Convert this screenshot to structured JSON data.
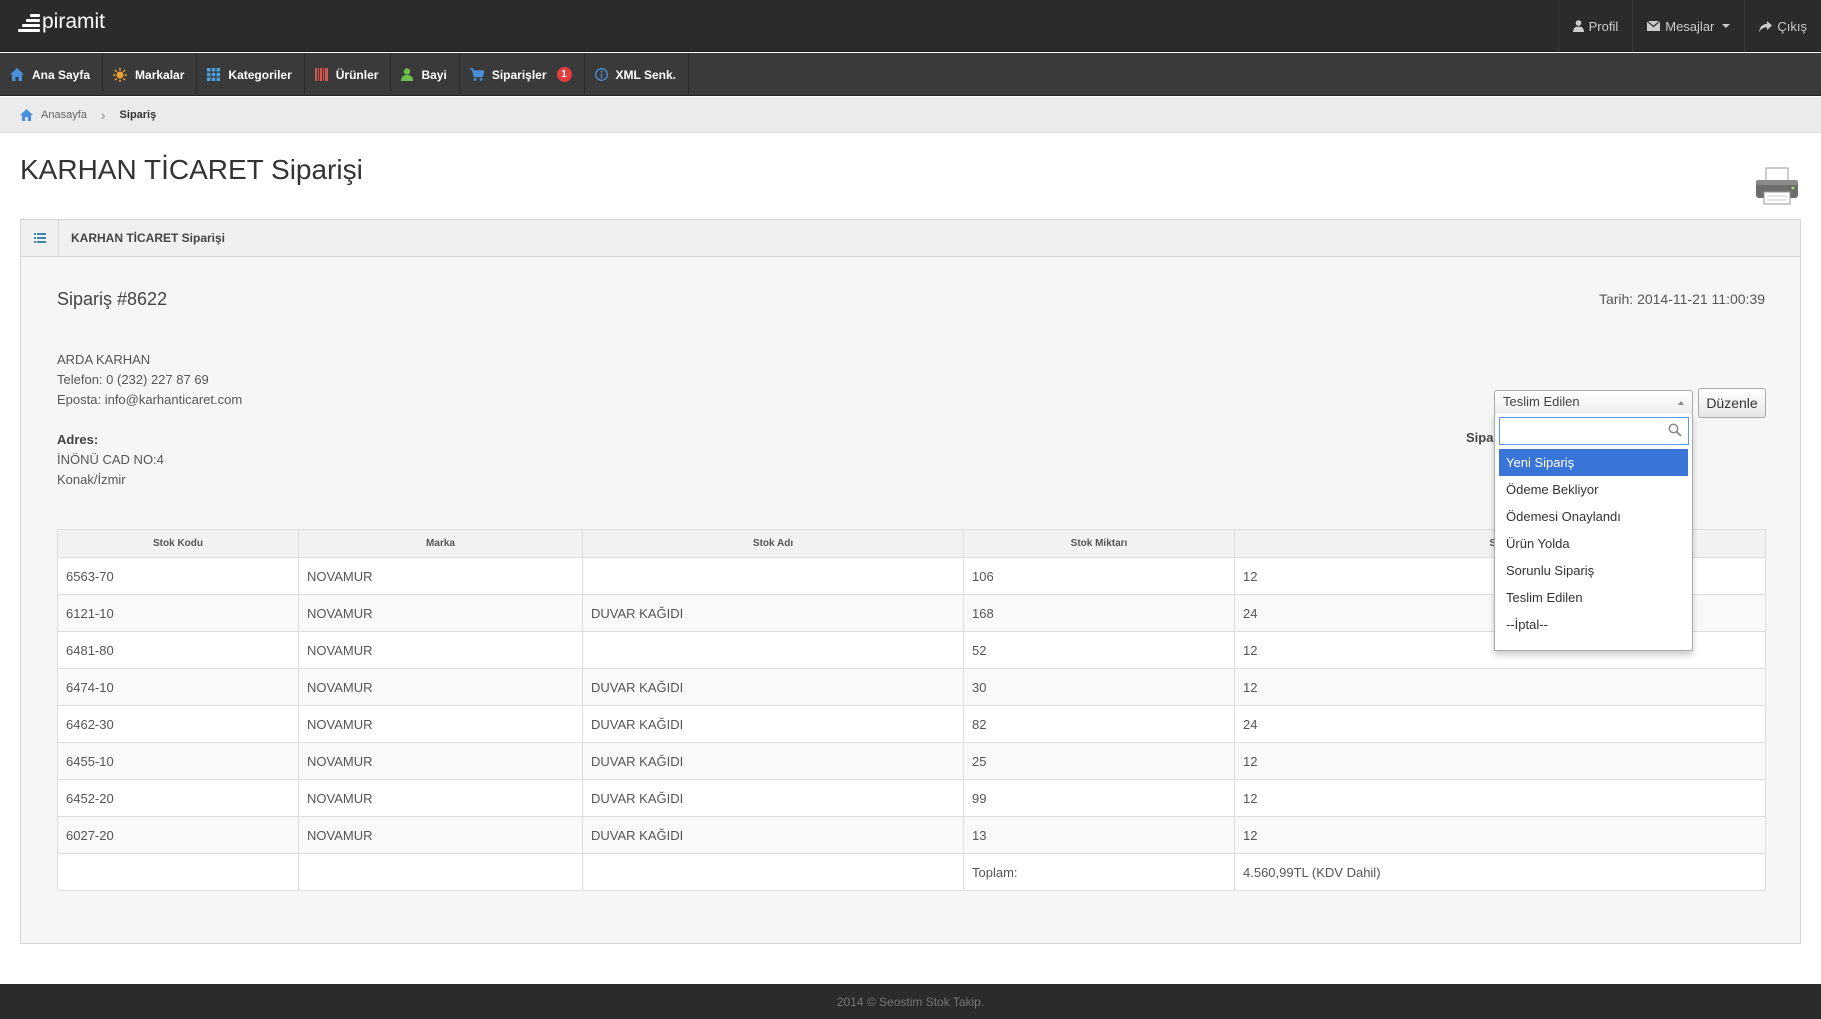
{
  "header": {
    "logo_text": "piramit",
    "profile_label": "Profil",
    "messages_label": "Mesajlar",
    "logout_label": "Çıkış"
  },
  "nav": [
    {
      "label": "Ana Sayfa",
      "icon": "home-icon",
      "color": "#4a90d9"
    },
    {
      "label": "Markalar",
      "icon": "sun-icon",
      "color": "#f0a030"
    },
    {
      "label": "Kategoriler",
      "icon": "grid-icon",
      "color": "#4aa3df"
    },
    {
      "label": "Ürünler",
      "icon": "barcode-icon",
      "color": "#d9534f"
    },
    {
      "label": "Bayi",
      "icon": "user-icon",
      "color": "#6cc04a"
    },
    {
      "label": "Siparişler",
      "icon": "cart-icon",
      "color": "#4a90d9",
      "badge": "1"
    },
    {
      "label": "XML Senk.",
      "icon": "info-icon",
      "color": "#4a90d9"
    }
  ],
  "breadcrumb": {
    "home": "Anasayfa",
    "current": "Sipariş"
  },
  "page": {
    "title": "KARHAN TİCARET Siparişi"
  },
  "panel": {
    "title": "KARHAN TİCARET Siparişi",
    "order_no": "Sipariş #8622",
    "date": "Tarih: 2014-11-21 11:00:39",
    "customer_name": "ARDA KARHAN",
    "phone": "Telefon: 0 (232) 227 87 69",
    "email": "Eposta: info@karhanticaret.com",
    "address_label": "Adres:",
    "address_line1": "İNÖNÜ CAD NO:4",
    "address_line2": "Konak/İzmir",
    "status_label": "Sipa",
    "status_selected": "Teslim Edilen",
    "edit_button": "Düzenle",
    "status_options": [
      "Yeni Sipariş",
      "Ödeme Bekliyor",
      "Ödemesi Onaylandı",
      "Ürün Yolda",
      "Sorunlu Sipariş",
      "Teslim Edilen",
      "--İptal--"
    ]
  },
  "table": {
    "headers": [
      "Stok Kodu",
      "Marka",
      "Stok Adı",
      "Stok Miktarı",
      "Sipa"
    ],
    "rows": [
      [
        "6563-70",
        "NOVAMUR",
        "",
        "106",
        "12"
      ],
      [
        "6121-10",
        "NOVAMUR",
        "DUVAR KAĞIDI",
        "168",
        "24"
      ],
      [
        "6481-80",
        "NOVAMUR",
        "",
        "52",
        "12"
      ],
      [
        "6474-10",
        "NOVAMUR",
        "DUVAR KAĞIDI",
        "30",
        "12"
      ],
      [
        "6462-30",
        "NOVAMUR",
        "DUVAR KAĞIDI",
        "82",
        "24"
      ],
      [
        "6455-10",
        "NOVAMUR",
        "DUVAR KAĞIDI",
        "25",
        "12"
      ],
      [
        "6452-20",
        "NOVAMUR",
        "DUVAR KAĞIDI",
        "99",
        "12"
      ],
      [
        "6027-20",
        "NOVAMUR",
        "DUVAR KAĞIDI",
        "13",
        "12"
      ]
    ],
    "total_label": "Toplam:",
    "total_value": "4.560,99TL (KDV Dahil)"
  },
  "footer": {
    "text": "2014 © Seostim Stok Takip."
  }
}
